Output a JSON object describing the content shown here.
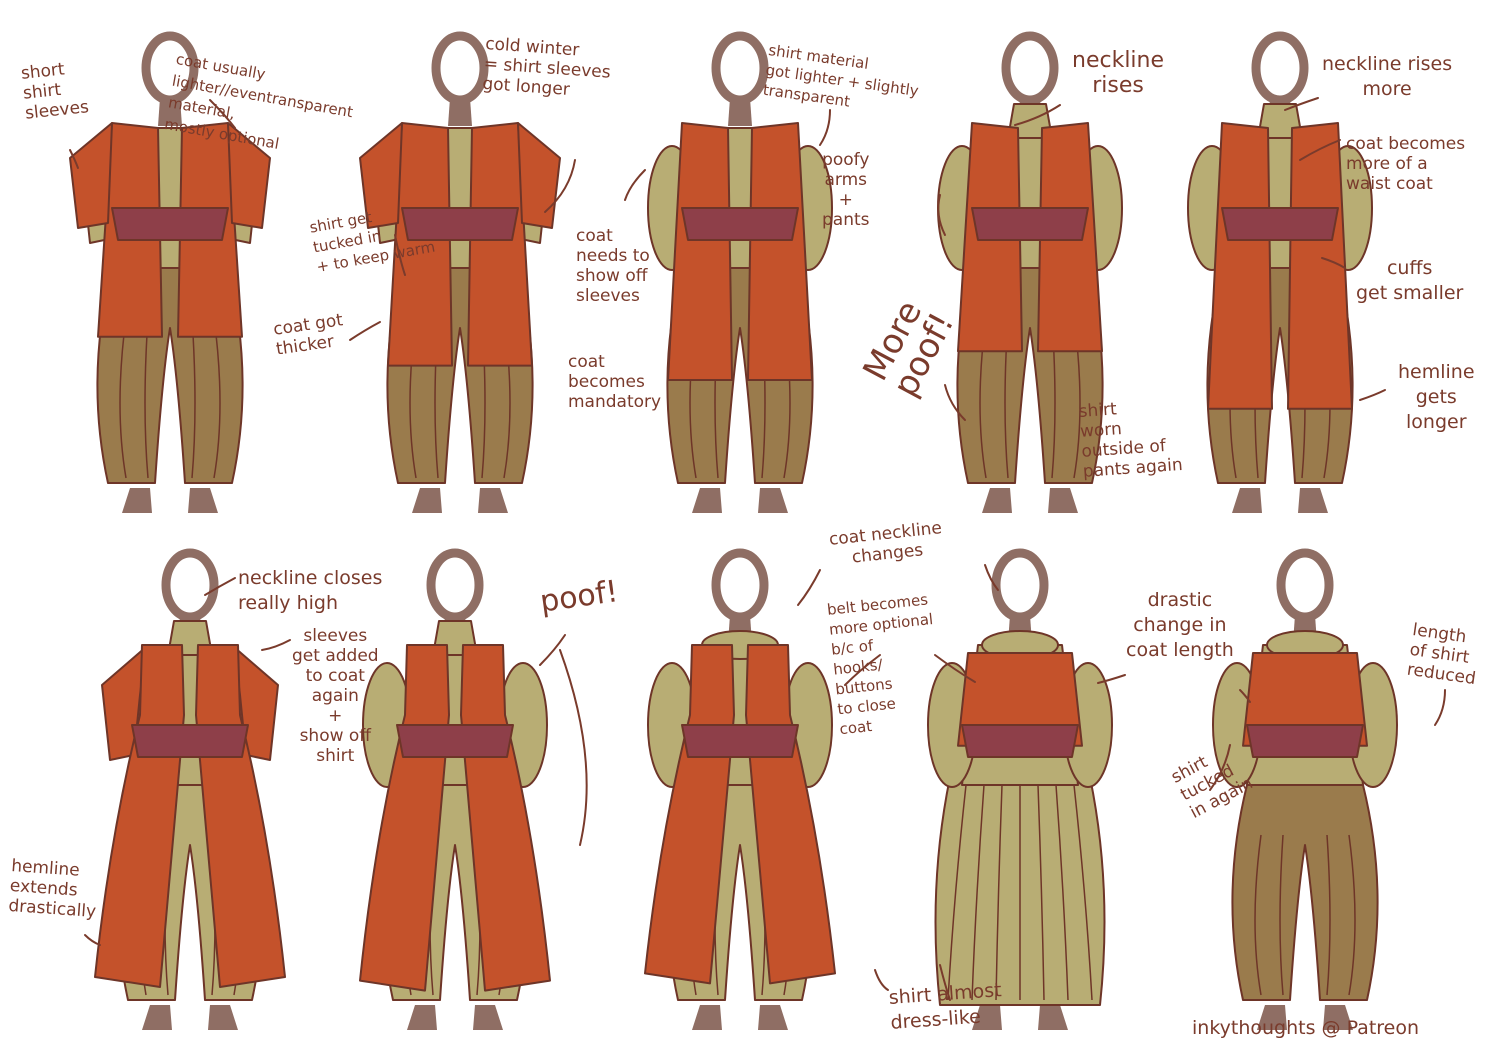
{
  "colors": {
    "coat": "#c4522b",
    "coat_edge": "#e06a3c",
    "shirt": "#b8ad74",
    "pants": "#9a7b4c",
    "belt": "#8e3f49",
    "skin": "#8f6e64",
    "line": "#6e3528",
    "ink": "#7a3b2c"
  },
  "figures": [
    {
      "label": "figure-1",
      "kind": "pants",
      "coat": "vest-short",
      "coat_len": 0.58,
      "sleeves": "short",
      "neck": "open"
    },
    {
      "label": "figure-2",
      "kind": "pants",
      "coat": "vest-short",
      "coat_len": 0.66,
      "sleeves": "short",
      "neck": "open"
    },
    {
      "label": "figure-3",
      "kind": "pants",
      "coat": "vest",
      "coat_len": 0.7,
      "sleeves": "puffy",
      "neck": "open"
    },
    {
      "label": "figure-4",
      "kind": "pants",
      "coat": "vest",
      "coat_len": 0.62,
      "sleeves": "puffy",
      "neck": "high"
    },
    {
      "label": "figure-5",
      "kind": "pants",
      "coat": "vest",
      "coat_len": 0.78,
      "sleeves": "puffy",
      "neck": "high"
    },
    {
      "label": "figure-6",
      "kind": "long",
      "coat": "long",
      "coat_len": 0.95,
      "sleeves": "coat",
      "neck": "closed"
    },
    {
      "label": "figure-7",
      "kind": "long",
      "coat": "long",
      "coat_len": 0.96,
      "sleeves": "puffy",
      "neck": "closed"
    },
    {
      "label": "figure-8",
      "kind": "long",
      "coat": "long",
      "coat_len": 0.94,
      "sleeves": "puffy",
      "neck": "ruff"
    },
    {
      "label": "figure-9",
      "kind": "dress",
      "coat": "jacket",
      "coat_len": 0.28,
      "sleeves": "puffy",
      "neck": "ruff"
    },
    {
      "label": "figure-10",
      "kind": "pants",
      "coat": "jacket",
      "coat_len": 0.28,
      "sleeves": "puffy",
      "neck": "ruff"
    }
  ],
  "notes": {
    "n1": "short\nshirt\nsleeves",
    "n2": "coat usually\nlighter//eventransparent\nmaterial,\nmostly optional",
    "n3": "cold winter\n= shirt sleeves\ngot longer",
    "n4": "shirt get\ntucked in\n+ to keep warm",
    "n5": "coat got\nthicker",
    "n6": "shirt material\ngot lighter + slightly\ntransparent",
    "n7": "poofy\narms\n+\npants",
    "n8": "coat\nneeds to\nshow off\nsleeves",
    "n9": "coat\nbecomes\nmandatory",
    "n10": "neckline\nrises",
    "n11": "More\npoof!",
    "n12": "shirt\nworn\noutside of\npants again",
    "n13": "neckline rises\nmore",
    "n14": "coat becomes\nmore of a\nwaist coat",
    "n15": "cuffs\nget smaller",
    "n16": "hemline\ngets\nlonger",
    "n17": "neckline closes\nreally high",
    "n18": "sleeves\nget added\nto coat\nagain\n+\nshow off\nshirt",
    "n19": "hemline\nextends\ndrastically",
    "n20": "poof!",
    "n21": "coat neckline\nchanges",
    "n22": "belt becomes\nmore optional\nb/c of\nhooks/\nbuttons\nto close\ncoat",
    "n23": "drastic\nchange in\ncoat length",
    "n24": "length\nof shirt\nreduced",
    "n25": "shirt\ntucked\nin again",
    "n26": "shirt almost\ndress-like",
    "signature": "inkythoughts @ Patreon"
  }
}
